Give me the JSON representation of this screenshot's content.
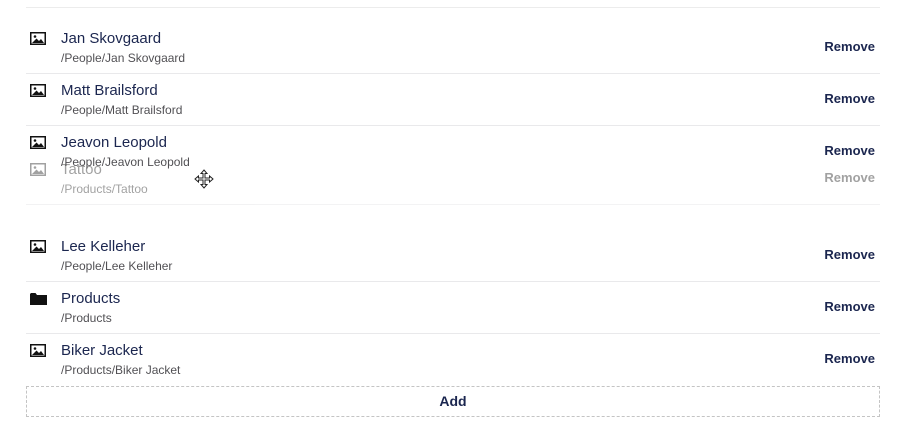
{
  "items": [
    {
      "name": "Jan Skovgaard",
      "path": "/People/Jan Skovgaard",
      "icon": "picture-icon",
      "remove_label": "Remove"
    },
    {
      "name": "Matt Brailsford",
      "path": "/People/Matt Brailsford",
      "icon": "picture-icon",
      "remove_label": "Remove"
    },
    {
      "name": "Jeavon Leopold",
      "path": "/People/Jeavon Leopold",
      "icon": "picture-icon",
      "remove_label": "Remove"
    },
    {
      "name": "Lee Kelleher",
      "path": "/People/Lee Kelleher",
      "icon": "picture-icon",
      "remove_label": "Remove"
    },
    {
      "name": "Products",
      "path": "/Products",
      "icon": "folder-icon",
      "remove_label": "Remove"
    },
    {
      "name": "Biker Jacket",
      "path": "/Products/Biker Jacket",
      "icon": "picture-icon",
      "remove_label": "Remove"
    }
  ],
  "dragging": {
    "name": "Tattoo",
    "path": "/Products/Tattoo",
    "icon": "picture-icon",
    "remove_label": "Remove"
  },
  "add_label": "Add",
  "colors": {
    "text": "#1b264f",
    "subtext": "#515054",
    "border": "#e9e9eb"
  }
}
